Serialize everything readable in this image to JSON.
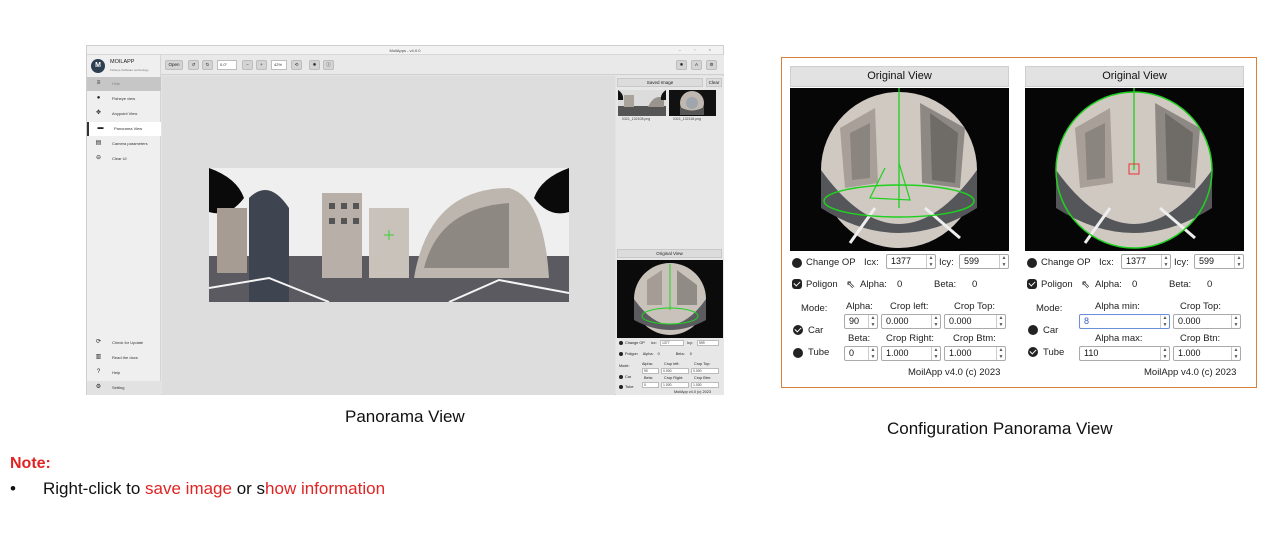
{
  "app": {
    "window_title": "MoilApps - v4.0.0",
    "window_controls": "– ▫ ×",
    "logo_name": "MOILAPP",
    "logo_tagline": "Fisheye Software technology",
    "sidebar_top": [
      {
        "label": "Hide",
        "icon": "menu-icon"
      },
      {
        "label": "Fisheye view",
        "icon": "fisheye-icon"
      },
      {
        "label": "Anypoint View",
        "icon": "anypoint-icon"
      },
      {
        "label": "Panorama View",
        "icon": "panorama-icon"
      },
      {
        "label": "Camera parameters",
        "icon": "document-icon"
      },
      {
        "label": "Clear UI",
        "icon": "minus-circle-icon"
      }
    ],
    "sidebar_bottom": [
      {
        "label": "Check for Update",
        "icon": "refresh-icon"
      },
      {
        "label": "Read the docs",
        "icon": "book-icon"
      },
      {
        "label": "Help",
        "icon": "help-icon"
      },
      {
        "label": "Setting",
        "icon": "gear-icon"
      }
    ],
    "toolbar": {
      "open_label": "Open",
      "rotation_value": "0.0°",
      "zoom_value": "42%"
    },
    "saved_image_header": "Saved Image",
    "clear_label": "Clear",
    "saved_images": [
      "0321_132108.png",
      "0321_132118.png"
    ],
    "original_view_header": "Original View",
    "mini": {
      "change_op": "Change OP",
      "icx_label": "Icx:",
      "icx_value": "1377",
      "icy_label": "Icy:",
      "icy_value": "599",
      "poligon": "Poligon",
      "alpha_label": "Alpha:",
      "alpha_value": "0",
      "beta_label": "Beta:",
      "beta_value": "0",
      "mode_label": "Mode:",
      "car_label": "Car",
      "tube_label": "Tube",
      "alpha_head": "Alpha:",
      "crop_left_head": "Crop left:",
      "crop_top_head": "Crop Top:",
      "alpha_val": "90",
      "crop_left_val": "0.000",
      "crop_top_val": "0.000",
      "beta_head": "Beta:",
      "crop_right_head": "Crop Right:",
      "crop_btm_head": "Crop Btm:",
      "beta_val": "0",
      "crop_right_val": "1.000",
      "crop_btm_val": "1.000",
      "footer": "MoilApp v4.0 (c) 2023"
    }
  },
  "captions": {
    "left": "Panorama View",
    "right": "Configuration Panorama View"
  },
  "config_left": {
    "header": "Original View",
    "change_op": "Change OP",
    "icx_label": "Icx:",
    "icx_value": "1377",
    "icy_label": "Icy:",
    "icy_value": "599",
    "poligon": "Poligon",
    "alpha_label": "Alpha:",
    "alpha_value": "0",
    "beta_label": "Beta:",
    "beta_value": "0",
    "mode_label": "Mode:",
    "car_label": "Car",
    "tube_label": "Tube",
    "alpha_head": "Alpha:",
    "crop_left_head": "Crop left:",
    "crop_top_head": "Crop Top:",
    "alpha_val": "90",
    "crop_left_val": "0.000",
    "crop_top_val": "0.000",
    "beta_head": "Beta:",
    "crop_right_head": "Crop Right:",
    "crop_btm_head": "Crop Btm:",
    "beta_val": "0",
    "crop_right_val": "1.000",
    "crop_btm_val": "1.000",
    "footer": "MoilApp v4.0 (c) 2023"
  },
  "config_right": {
    "header": "Original View",
    "change_op": "Change OP",
    "icx_label": "Icx:",
    "icx_value": "1377",
    "icy_label": "Icy:",
    "icy_value": "599",
    "poligon": "Poligon",
    "alpha_label": "Alpha:",
    "alpha_value": "0",
    "beta_label": "Beta:",
    "beta_value": "0",
    "mode_label": "Mode:",
    "car_label": "Car",
    "tube_label": "Tube",
    "alpha_min_head": "Alpha min:",
    "crop_top_head": "Crop Top:",
    "alpha_min_val": "8",
    "crop_top_val": "0.000",
    "alpha_max_head": "Alpha max:",
    "crop_btn_head": "Crop Btn:",
    "alpha_max_val": "110",
    "crop_btn_val": "1.000",
    "footer": "MoilApp v4.0 (c) 2023"
  },
  "note": {
    "title": "Note:",
    "bullet": "•",
    "prefix": "Right-click to ",
    "link1": "save image",
    "middle": " or s",
    "link2": "how information"
  },
  "colors": {
    "accent_red": "#e02424",
    "config_border": "#d9813a",
    "overlay_green": "#1fd11f"
  }
}
